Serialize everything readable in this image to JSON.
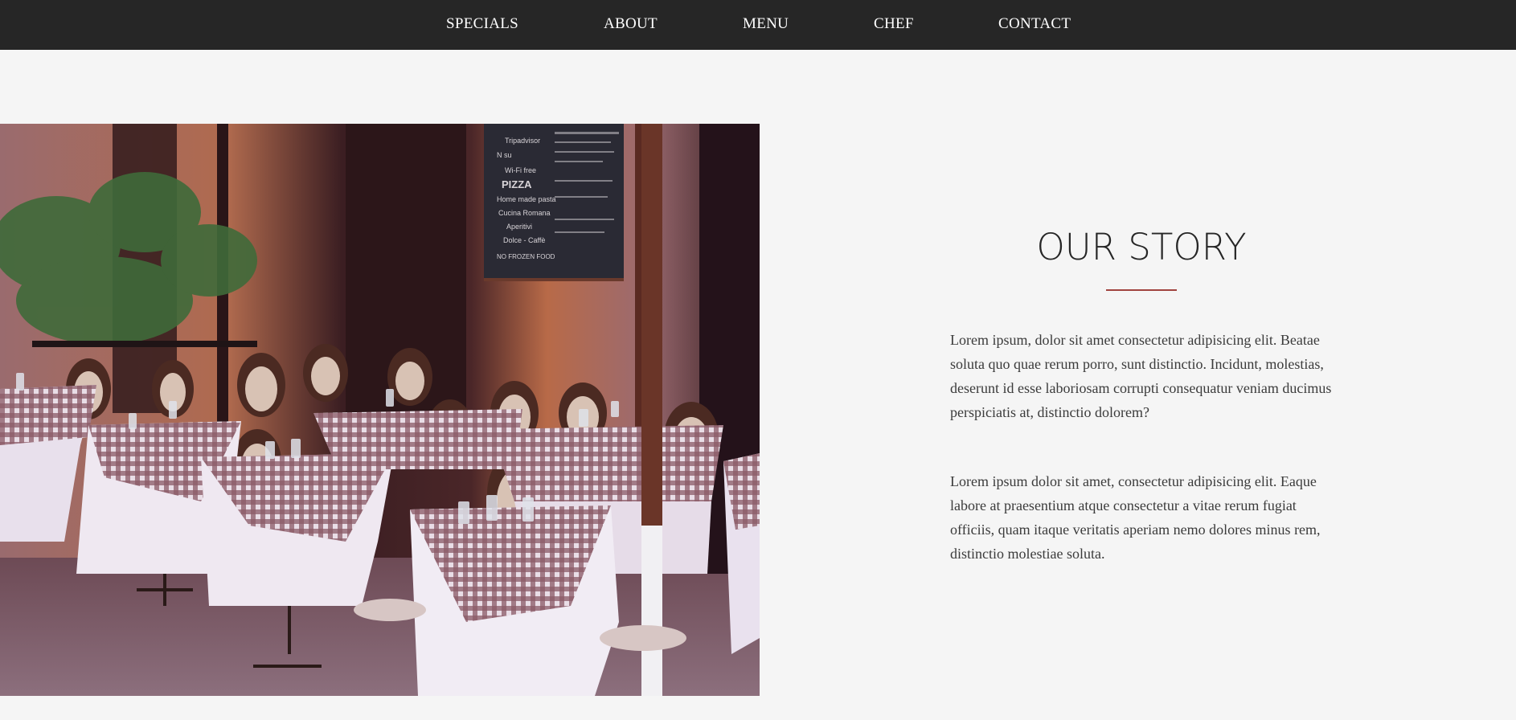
{
  "nav": {
    "items": [
      {
        "label": "SPECIALS"
      },
      {
        "label": "ABOUT"
      },
      {
        "label": "MENU"
      },
      {
        "label": "CHEF"
      },
      {
        "label": "CONTACT"
      }
    ]
  },
  "hero_image": {
    "chalkboard_lines": [
      "Tripadvisor",
      "N        su",
      "Wi-Fi free",
      "PIZZA",
      "Home made pasta",
      "Cucina Romana",
      "Aperitivi",
      "Dolce - Caffè",
      "NO FROZEN FOOD"
    ]
  },
  "story": {
    "title": "OUR STORY",
    "paragraphs": [
      "Lorem ipsum, dolor sit amet consectetur adipisicing elit. Beatae soluta quo quae rerum porro, sunt distinctio. Incidunt, molestias, deserunt id esse laboriosam corrupti consequatur veniam ducimus perspiciatis at, distinctio dolorem?",
      "Lorem ipsum dolor sit amet, consectetur adipisicing elit. Eaque labore at praesentium atque consectetur a vitae rerum fugiat officiis, quam itaque veritatis aperiam nemo dolores minus rem, distinctio molestiae soluta."
    ]
  },
  "colors": {
    "navbar_bg": "#262626",
    "page_bg": "#f5f5f5",
    "accent_divider": "#a0433f",
    "title_text": "#262626",
    "body_text": "#3b3b3b"
  }
}
